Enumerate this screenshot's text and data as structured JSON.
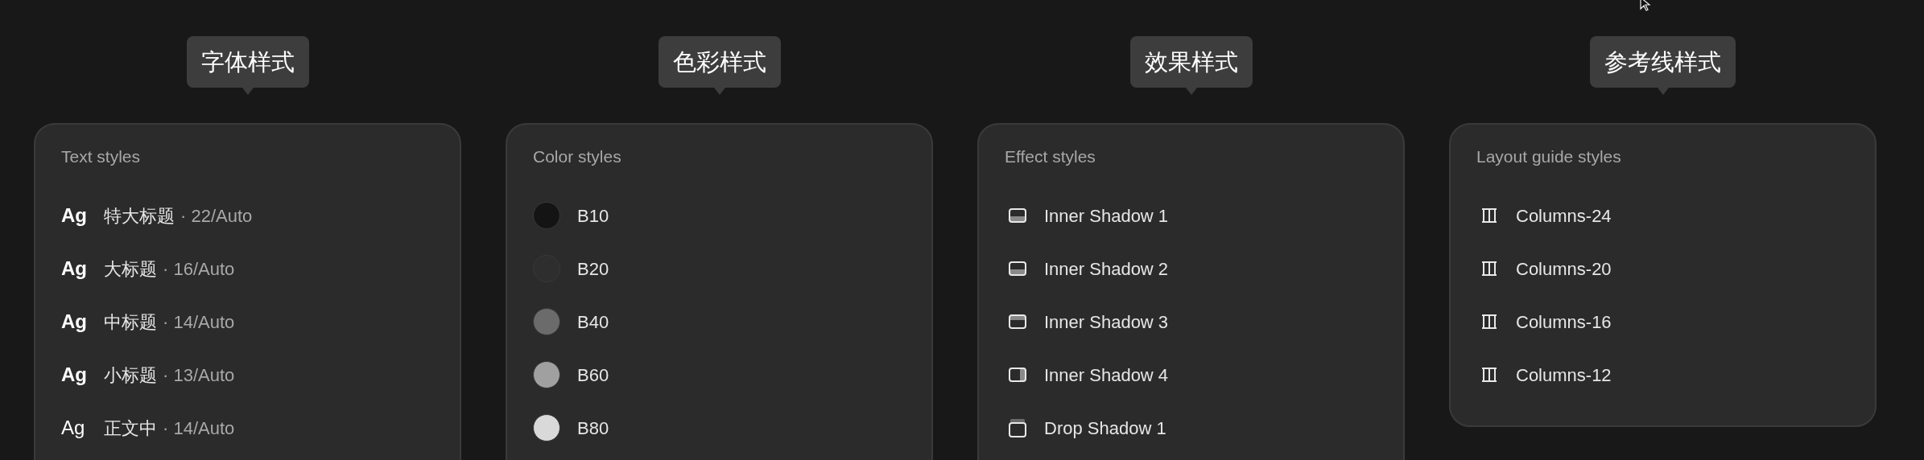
{
  "panels": [
    {
      "tooltip": "字体样式",
      "heading": "Text styles",
      "kind": "text",
      "items": [
        {
          "preview": "Ag",
          "bold": true,
          "name": "特大标题",
          "spec": "· 22/Auto"
        },
        {
          "preview": "Ag",
          "bold": true,
          "name": "大标题",
          "spec": "· 16/Auto"
        },
        {
          "preview": "Ag",
          "bold": true,
          "name": "中标题",
          "spec": "· 14/Auto"
        },
        {
          "preview": "Ag",
          "bold": true,
          "name": "小标题",
          "spec": "· 13/Auto"
        },
        {
          "preview": "Ag",
          "bold": false,
          "name": "正文中",
          "spec": "· 14/Auto"
        }
      ]
    },
    {
      "tooltip": "色彩样式",
      "heading": "Color styles",
      "kind": "color",
      "items": [
        {
          "color": "#141414",
          "name": "B10"
        },
        {
          "color": "#2e2e2e",
          "name": "B20"
        },
        {
          "color": "#6b6b6b",
          "name": "B40"
        },
        {
          "color": "#a0a0a0",
          "name": "B60"
        },
        {
          "color": "#d9d9d9",
          "name": "B80"
        }
      ]
    },
    {
      "tooltip": "效果样式",
      "heading": "Effect styles",
      "kind": "effect",
      "items": [
        {
          "kind": "bottom",
          "name": "Inner Shadow 1"
        },
        {
          "kind": "bottom",
          "name": "Inner Shadow 2"
        },
        {
          "kind": "top",
          "name": "Inner Shadow 3"
        },
        {
          "kind": "right",
          "name": "Inner Shadow 4"
        },
        {
          "kind": "drop",
          "name": "Drop Shadow 1"
        }
      ]
    },
    {
      "tooltip": "参考线样式",
      "heading": "Layout guide styles",
      "kind": "layout",
      "items": [
        {
          "name": "Columns-24"
        },
        {
          "name": "Columns-20"
        },
        {
          "name": "Columns-16"
        },
        {
          "name": "Columns-12"
        }
      ]
    }
  ]
}
